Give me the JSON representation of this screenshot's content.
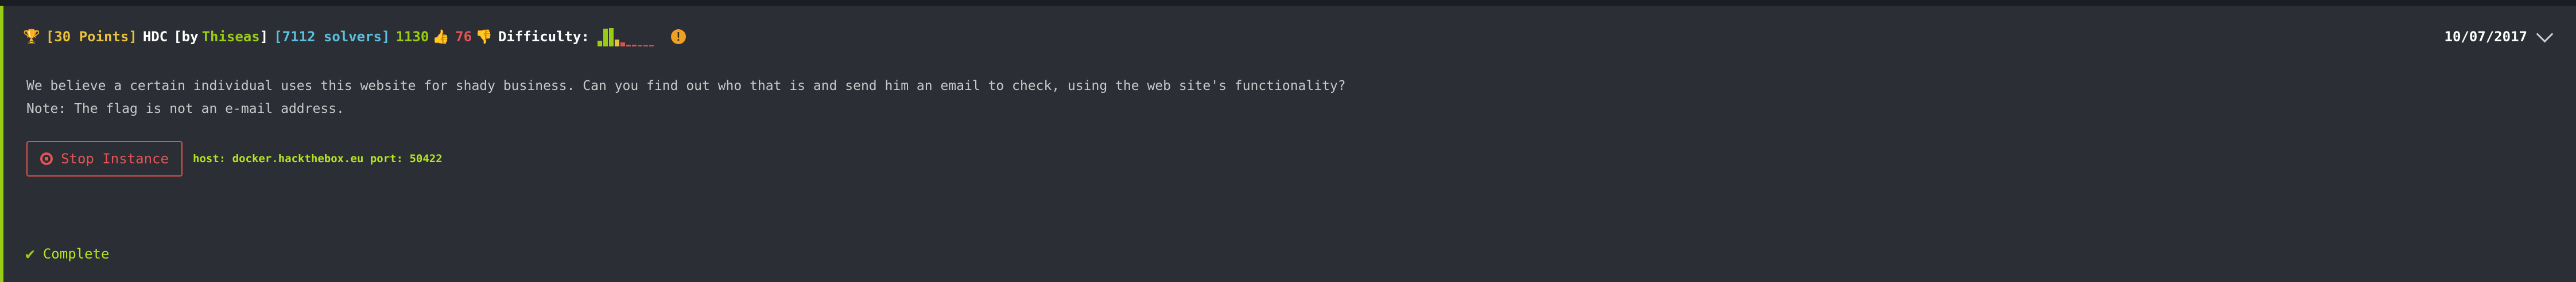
{
  "header": {
    "trophy_icon": "trophy-icon",
    "points": "[30 Points]",
    "challenge_name": "HDC",
    "by_label": "[by",
    "author": "Thiseas",
    "author_close": "]",
    "solvers": "[7112 solvers]",
    "likes": "1130",
    "dislikes": "76",
    "difficulty_label": "Difficulty:",
    "difficulty_bars": [
      0.3,
      0.9,
      0.95,
      0.35,
      0.2,
      0.1,
      0.08,
      0.05,
      0.05,
      0.05
    ],
    "info_symbol": "!",
    "date": "10/07/2017"
  },
  "description": {
    "line1": "We believe a certain individual uses this website for shady business. Can you find out who that is and send him an email to check, using the web site's functionality?",
    "line2": "Note: The flag is not an e-mail address."
  },
  "instance": {
    "stop_label": "Stop Instance",
    "host_text": "host: docker.hackthebox.eu port: 50422"
  },
  "status": {
    "complete_label": "Complete"
  },
  "colors": {
    "accent": "#9acc14",
    "points": "#e8c23a",
    "solvers": "#5bc0de",
    "danger": "#d9534f"
  }
}
